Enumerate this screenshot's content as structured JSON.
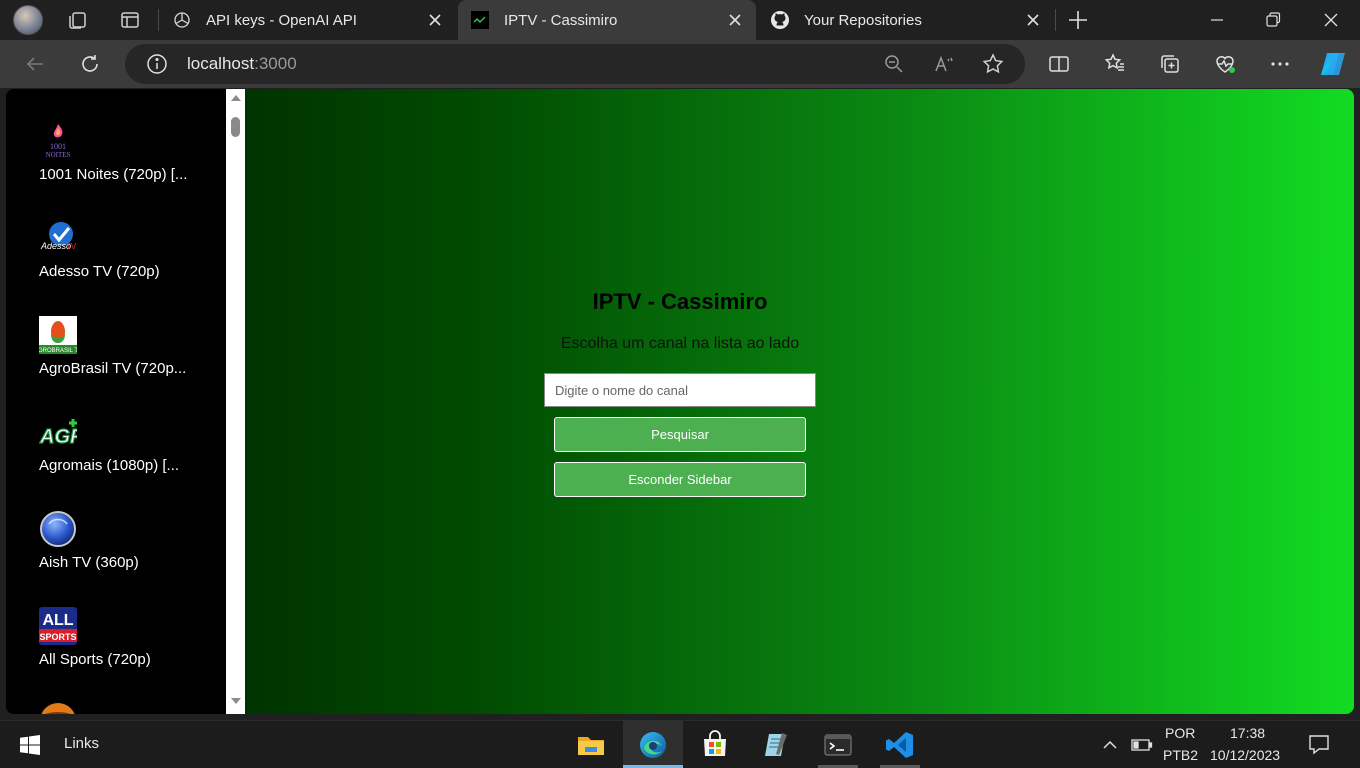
{
  "browser": {
    "tabs": [
      {
        "title": "API keys - OpenAI API",
        "favicon": "openai-icon",
        "active": false
      },
      {
        "title": "IPTV - Cassimiro",
        "favicon": "iptv-icon",
        "active": true
      },
      {
        "title": "Your Repositories",
        "favicon": "github-icon",
        "active": false
      }
    ],
    "address": {
      "host": "localhost",
      "port": ":3000"
    }
  },
  "sidebar": {
    "channels": [
      {
        "name": "1001 Noites (720p) [...",
        "logo": "1001-noites-logo"
      },
      {
        "name": "Adesso TV (720p)",
        "logo": "adesso-tv-logo"
      },
      {
        "name": "AgroBrasil TV (720p...",
        "logo": "agrobrasil-tv-logo"
      },
      {
        "name": "Agromais (1080p) [...",
        "logo": "agromais-logo"
      },
      {
        "name": "Aish TV (360p)",
        "logo": "aish-tv-logo"
      },
      {
        "name": "All Sports (720p)",
        "logo": "all-sports-logo"
      }
    ]
  },
  "main": {
    "title": "IPTV - Cassimiro",
    "subtitle": "Escolha um canal na lista ao lado",
    "search_placeholder": "Digite o nome do canal",
    "search_button": "Pesquisar",
    "hide_sidebar_button": "Esconder Sidebar"
  },
  "taskbar": {
    "links_label": "Links",
    "language": "POR",
    "layout": "PTB2",
    "time": "17:38",
    "date": "10/12/2023"
  },
  "colors": {
    "accent_green": "#4caf50",
    "gradient_start": "#003300",
    "gradient_end": "#12dc22"
  }
}
